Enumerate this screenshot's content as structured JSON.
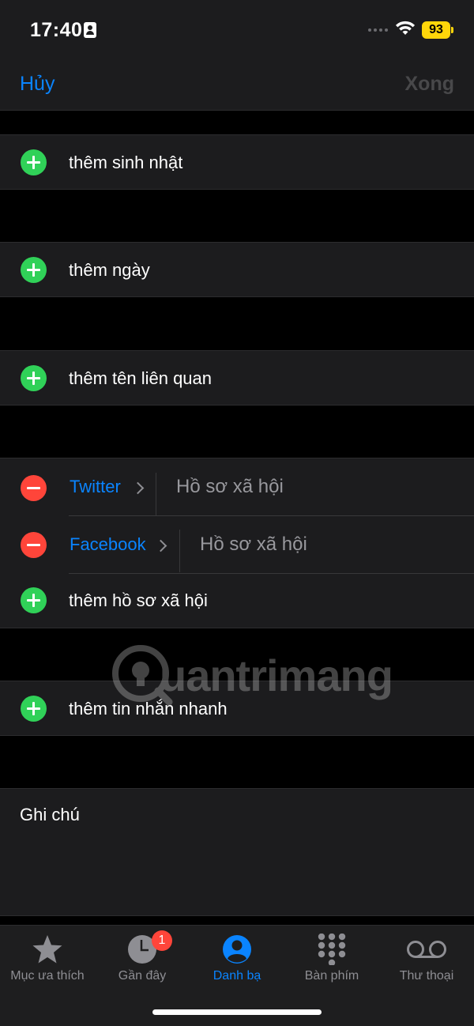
{
  "status_bar": {
    "time": "17:40",
    "battery": "93"
  },
  "nav": {
    "cancel": "Hủy",
    "done": "Xong"
  },
  "rows": {
    "birthday": "thêm sinh nhật",
    "date": "thêm ngày",
    "related_name": "thêm tên liên quan",
    "social_profiles": [
      {
        "service": "Twitter",
        "value": "Hồ sơ xã hội"
      },
      {
        "service": "Facebook",
        "value": "Hồ sơ xã hội"
      }
    ],
    "add_social": "thêm hồ sơ xã hội",
    "instant_message": "thêm tin nhắn nhanh"
  },
  "notes": {
    "label": "Ghi chú"
  },
  "watermark": "uantrimang",
  "tab_bar": {
    "tabs": [
      {
        "label": "Mục ưa thích",
        "icon": "star-icon"
      },
      {
        "label": "Gần đây",
        "icon": "clock-icon",
        "badge": "1"
      },
      {
        "label": "Danh bạ",
        "icon": "person-icon",
        "active": true
      },
      {
        "label": "Bàn phím",
        "icon": "keypad-icon"
      },
      {
        "label": "Thư thoại",
        "icon": "voicemail-icon"
      }
    ]
  },
  "colors": {
    "accent": "#0a84ff",
    "add": "#30d158",
    "remove": "#ff453a",
    "battery": "#ffd60a"
  }
}
